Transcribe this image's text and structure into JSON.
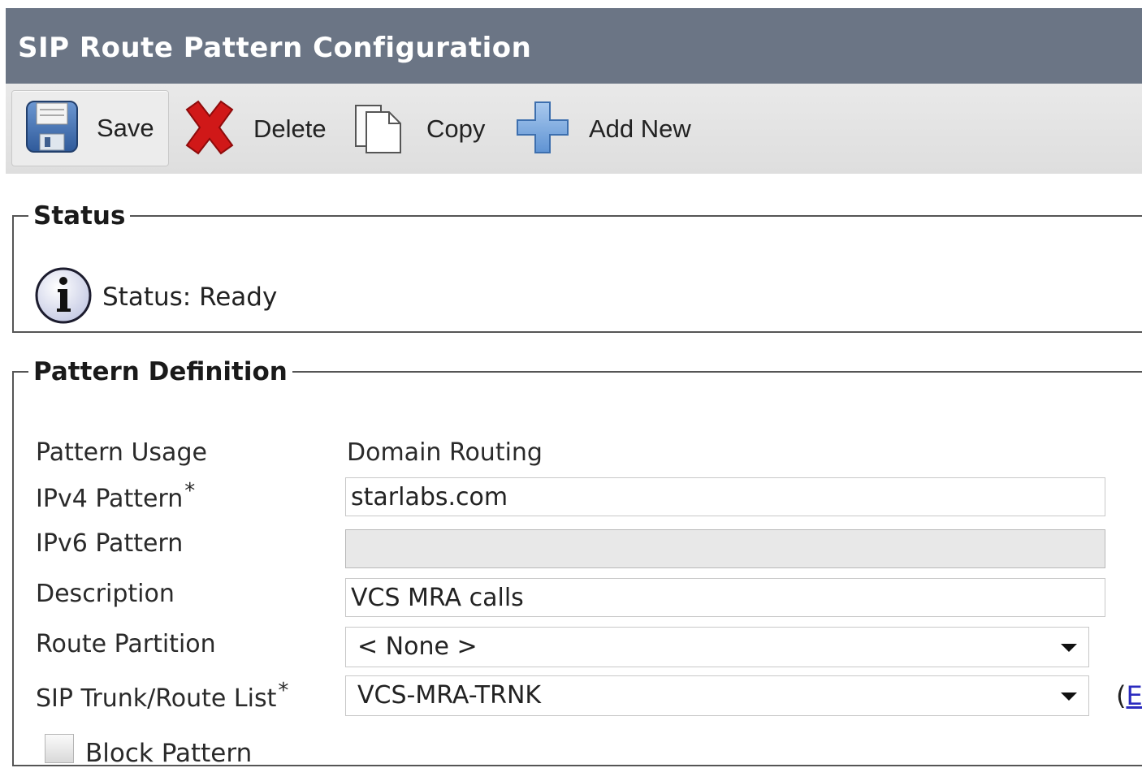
{
  "header": {
    "title": "SIP Route Pattern Configuration"
  },
  "toolbar": {
    "save": "Save",
    "delete": "Delete",
    "copy": "Copy",
    "add_new": "Add New",
    "icons": {
      "save": "floppy-disk-icon",
      "delete": "red-x-icon",
      "copy": "copy-document-icon",
      "add_new": "plus-icon"
    },
    "colors": {
      "save_blue": "#3f6fb0",
      "delete_red": "#d01818",
      "add_blue": "#7aa8dc"
    }
  },
  "status_section": {
    "legend": "Status",
    "icon": "info-icon",
    "text": "Status: Ready"
  },
  "pattern_definition": {
    "legend": "Pattern Definition",
    "pattern_usage_label": "Pattern Usage",
    "pattern_usage_value": "Domain Routing",
    "ipv4_label": "IPv4 Pattern",
    "ipv4_value": "starlabs.com",
    "ipv6_label": "IPv6 Pattern",
    "ipv6_value": "",
    "description_label": "Description",
    "description_value": "VCS MRA calls",
    "route_partition_label": "Route Partition",
    "route_partition_value": "< None >",
    "trunk_label": "SIP Trunk/Route List",
    "trunk_value": "VCS-MRA-TRNK",
    "edit_link_open": "(",
    "edit_link_text": "E",
    "block_pattern_label": "Block Pattern",
    "block_pattern_checked": false,
    "required_marker": "*"
  }
}
